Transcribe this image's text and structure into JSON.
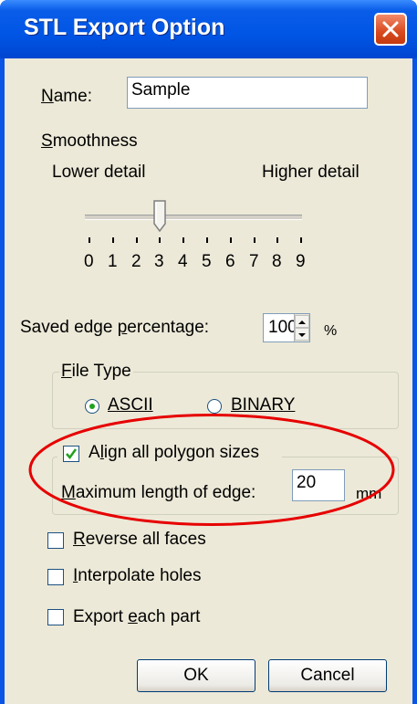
{
  "window": {
    "title": "STL Export Option"
  },
  "name_field": {
    "label": "Name:",
    "value": "Sample"
  },
  "smoothness": {
    "label": "Smoothness",
    "lower_label": "Lower detail",
    "higher_label": "Higher detail",
    "value": 3,
    "ticks": [
      "0",
      "1",
      "2",
      "3",
      "4",
      "5",
      "6",
      "7",
      "8",
      "9"
    ]
  },
  "saved_edge": {
    "label": "Saved edge percentage:",
    "value": "100",
    "unit": "%"
  },
  "file_type": {
    "legend": "File Type",
    "options": [
      {
        "label": "ASCII",
        "selected": true
      },
      {
        "label": "BINARY",
        "selected": false
      }
    ]
  },
  "align_polygons": {
    "label": "Align all polygon sizes",
    "checked": true,
    "max_edge_label": "Maximum length of edge:",
    "max_edge_value": "20",
    "max_edge_unit": "mm"
  },
  "options": {
    "reverse_faces": {
      "label": "Reverse all faces",
      "checked": false
    },
    "interpolate_holes": {
      "label": "Interpolate holes",
      "checked": false
    },
    "export_each_part": {
      "label": "Export each part",
      "checked": false
    }
  },
  "buttons": {
    "ok": "OK",
    "cancel": "Cancel"
  },
  "colors": {
    "title_bar": "#0055e5",
    "dialog_bg": "#ece9d8",
    "annotation": "#e60000"
  }
}
